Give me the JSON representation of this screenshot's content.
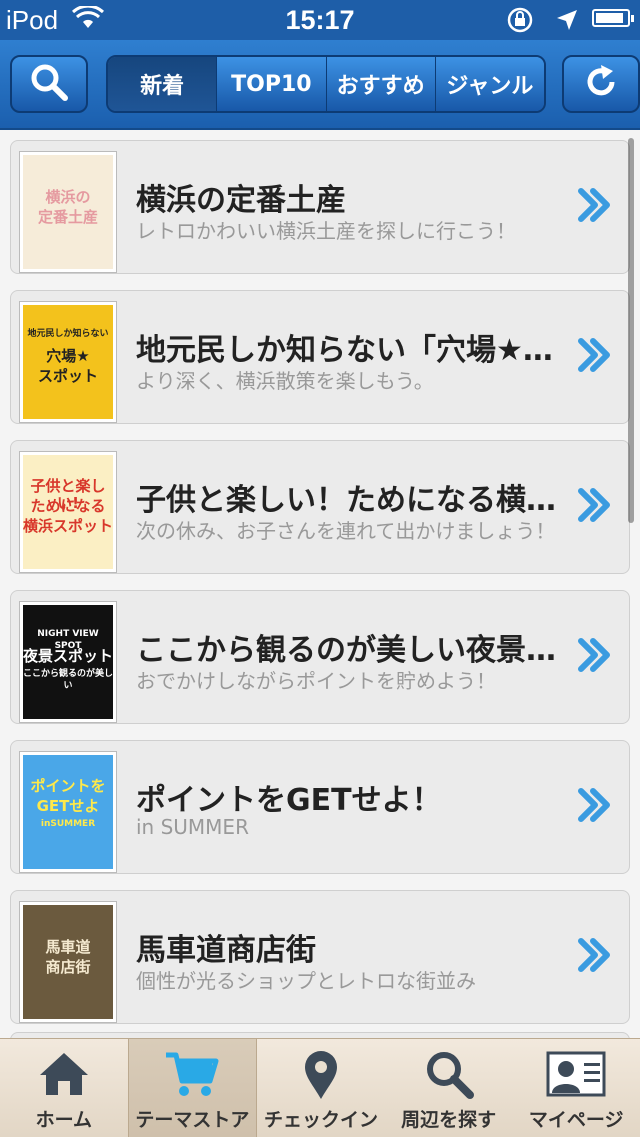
{
  "status_bar": {
    "carrier": "iPod",
    "time": "15:17",
    "battery_level": 0.9
  },
  "nav": {
    "segments": [
      {
        "label": "新着",
        "active": true
      },
      {
        "label": "TOP10",
        "active": false
      },
      {
        "label": "おすすめ",
        "active": false
      },
      {
        "label": "ジャンル",
        "active": false
      }
    ]
  },
  "themes": [
    {
      "title": "横浜の定番土産",
      "subtitle": "レトロかわいい横浜土産を探しに行こう！",
      "thumb_text": "横浜の\n定番土産",
      "thumb_bg": "#f6ecd9",
      "thumb_fg": "#e59aa0"
    },
    {
      "title": "地元民しか知らない「穴場★スポット」",
      "subtitle": "より深く、横浜散策を楽しもう。",
      "thumb_text": "地元民しか知らない\n穴場★\nスポット",
      "thumb_bg": "#f3c21c",
      "thumb_fg": "#222222"
    },
    {
      "title": "子供と楽しい！ためになる横浜スポット",
      "subtitle": "次の休み、お子さんを連れて出かけましょう！",
      "thumb_text": "子供と楽しい!\nためになる\n横浜スポット",
      "thumb_bg": "#fbefc4",
      "thumb_fg": "#d8372b"
    },
    {
      "title": "ここから観るのが美しい夜景スポット",
      "subtitle": "おでかけしながらポイントを貯めよう！",
      "thumb_text": "NIGHT VIEW SPOT\n夜景スポット\nここから観るのが美しい",
      "thumb_bg": "#111111",
      "thumb_fg": "#ffffff"
    },
    {
      "title": "ポイントをGETせよ！",
      "subtitle": "in SUMMER",
      "thumb_text": "ポイントを\nGETせよ\ninSUMMER",
      "thumb_bg": "#4aa7e8",
      "thumb_fg": "#ffe94a"
    },
    {
      "title": "馬車道商店街",
      "subtitle": "個性が光るショップとレトロな街並み",
      "thumb_text": "馬車道\n商店街",
      "thumb_bg": "#6b5a3e",
      "thumb_fg": "#f5ead0"
    }
  ],
  "tabs": [
    {
      "label": "ホーム",
      "icon": "home-icon",
      "active": false
    },
    {
      "label": "テーマストア",
      "icon": "cart-icon",
      "active": true
    },
    {
      "label": "チェックイン",
      "icon": "map-pin-icon",
      "active": false
    },
    {
      "label": "周辺を探す",
      "icon": "search-icon",
      "active": false
    },
    {
      "label": "マイページ",
      "icon": "profile-card-icon",
      "active": false
    }
  ],
  "colors": {
    "nav_blue": "#1e5ea8",
    "chevron_blue": "#3a9be0",
    "active_tab_icon": "#29a9e6"
  }
}
